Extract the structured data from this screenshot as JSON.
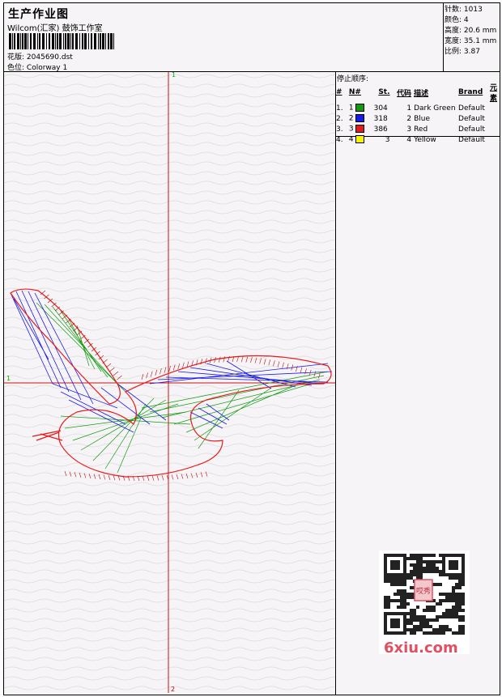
{
  "header": {
    "title": "生产作业图",
    "company": "Wilcom(汇家) 鼓饰工作室",
    "design_label": "花版:",
    "design_value": "2045690.dst",
    "colorway_label": "色位:",
    "colorway_value": "Colorway 1"
  },
  "stats": {
    "stitches": "针数: 1013",
    "colors": "颜色: 4",
    "height": "高度: 20.6 mm",
    "width": "宽度: 35.1 mm",
    "scale": "比例: 3.87"
  },
  "stop_sequence": {
    "title": "停止顺序:",
    "headers": [
      "#",
      "N#",
      "St.",
      "代码",
      "描述",
      "Brand",
      "元素"
    ],
    "rows": [
      {
        "idx": "1.",
        "n": "1",
        "st": "304",
        "code": "1",
        "desc": "Dark Green",
        "brand": "Default",
        "color": "#109a10"
      },
      {
        "idx": "2.",
        "n": "2",
        "st": "318",
        "code": "2",
        "desc": "Blue",
        "brand": "Default",
        "color": "#1a1ae6"
      },
      {
        "idx": "3.",
        "n": "3",
        "st": "386",
        "code": "3",
        "desc": "Red",
        "brand": "Default",
        "color": "#e61a1a"
      },
      {
        "idx": "4.",
        "n": "4",
        "st": "3",
        "code": "4",
        "desc": "Yellow",
        "brand": "Default",
        "color": "#f5f50a"
      }
    ]
  },
  "axes": {
    "top_label": "1",
    "left_label": "1",
    "bottom_label": "2"
  },
  "watermark": {
    "url": "6xiu.com",
    "seal": "哎秀"
  }
}
